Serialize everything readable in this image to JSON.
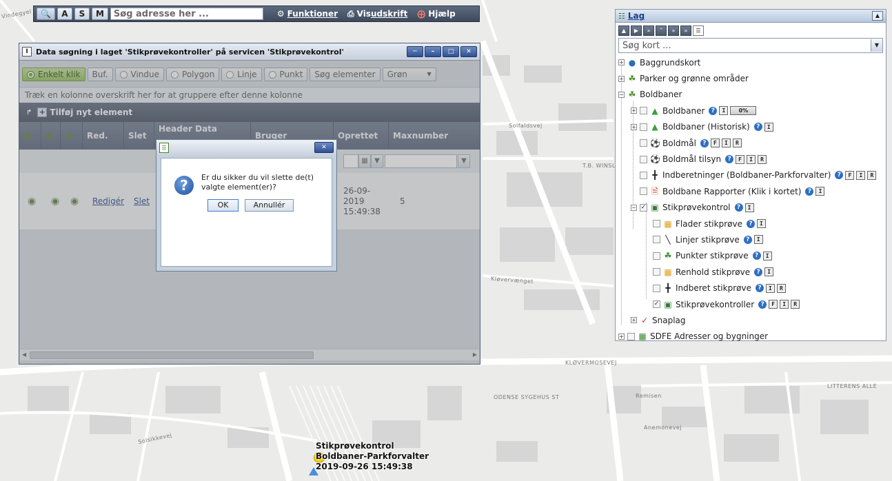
{
  "toolbar": {
    "btn_a": "A",
    "btn_s": "S",
    "btn_m": "M",
    "search_placeholder": "Søg adresse her ...",
    "funktioner": "Funktioner",
    "vis": "Vis ",
    "udskrift": "udskrift",
    "hjaelp": "Hjælp"
  },
  "layers": {
    "title": "Lag",
    "search_placeholder": "Søg kort ...",
    "items": [
      {
        "label": "Baggrundskort"
      },
      {
        "label": "Parker og grønne områder"
      },
      {
        "label": "Boldbaner"
      },
      {
        "label": "Boldbaner",
        "progress": "0%"
      },
      {
        "label": "Boldbaner (Historisk)"
      },
      {
        "label": "Boldmål"
      },
      {
        "label": "Boldmål tilsyn"
      },
      {
        "label": "Indberetninger (Boldbaner-Parkforvalter)"
      },
      {
        "label": "Boldbane Rapporter (Klik i kortet)"
      },
      {
        "label": "Stikprøvekontrol"
      },
      {
        "label": "Flader stikprøve"
      },
      {
        "label": "Linjer stikprøve"
      },
      {
        "label": "Punkter stikprøve"
      },
      {
        "label": "Renhold stikprøve"
      },
      {
        "label": "Indberet stikprøve"
      },
      {
        "label": "Stikprøvekontroller"
      },
      {
        "label": "Snaplag"
      },
      {
        "label": "SDFE Adresser og bygninger"
      }
    ],
    "badges": {
      "q": "?",
      "f": "F",
      "i": "I",
      "r": "R"
    }
  },
  "datawindow": {
    "title": "Data søgning i laget 'Stikprøvekontroller' på servicen 'Stikprøvekontrol'",
    "modes": {
      "enkelt": "Enkelt klik",
      "buf": "Buf.",
      "vindue": "Vindue",
      "polygon": "Polygon",
      "linje": "Linje",
      "punkt": "Punkt",
      "soeg": "Søg elementer",
      "color": "Grøn"
    },
    "group_hint": "Træk en kolonne overskrift her for at gruppere efter denne kolonne",
    "add_label": "Tilføj nyt element",
    "columns": {
      "red": "Red.",
      "slet": "Slet",
      "header_data": "Header Data",
      "bruger": "Bruger",
      "oprettet": "Oprettet",
      "maxnumber": "Maxnumber"
    },
    "row": {
      "rediger": "Redigér",
      "slet": "Slet",
      "oprettet_line1": "26-09-",
      "oprettet_line2": "2019",
      "oprettet_line3": "15:49:38",
      "maxnumber": "5"
    }
  },
  "dialog": {
    "message": "Er du sikker du vil slette de(t) valgte element(er)?",
    "ok": "OK",
    "cancel": "Annullér"
  },
  "map": {
    "marker_line1": "Stikprøvekontrol",
    "marker_line2": "Boldbaner-Parkforvalter",
    "marker_line3": "2019-09-26 15:49:38",
    "streets": {
      "s1": "Vindegyel",
      "s2": "Solfaldsvej",
      "s3": "T.B. WINSLØ",
      "s4": "Kløvervænget",
      "s5": "KLØVERMOSEVEJ",
      "s6": "ODENSE SYGEHUS ST",
      "s7": "Remisen",
      "s8": "Anemonevej",
      "s9": "LITTERENS ALLE",
      "s10": "Solsikkevej"
    }
  }
}
